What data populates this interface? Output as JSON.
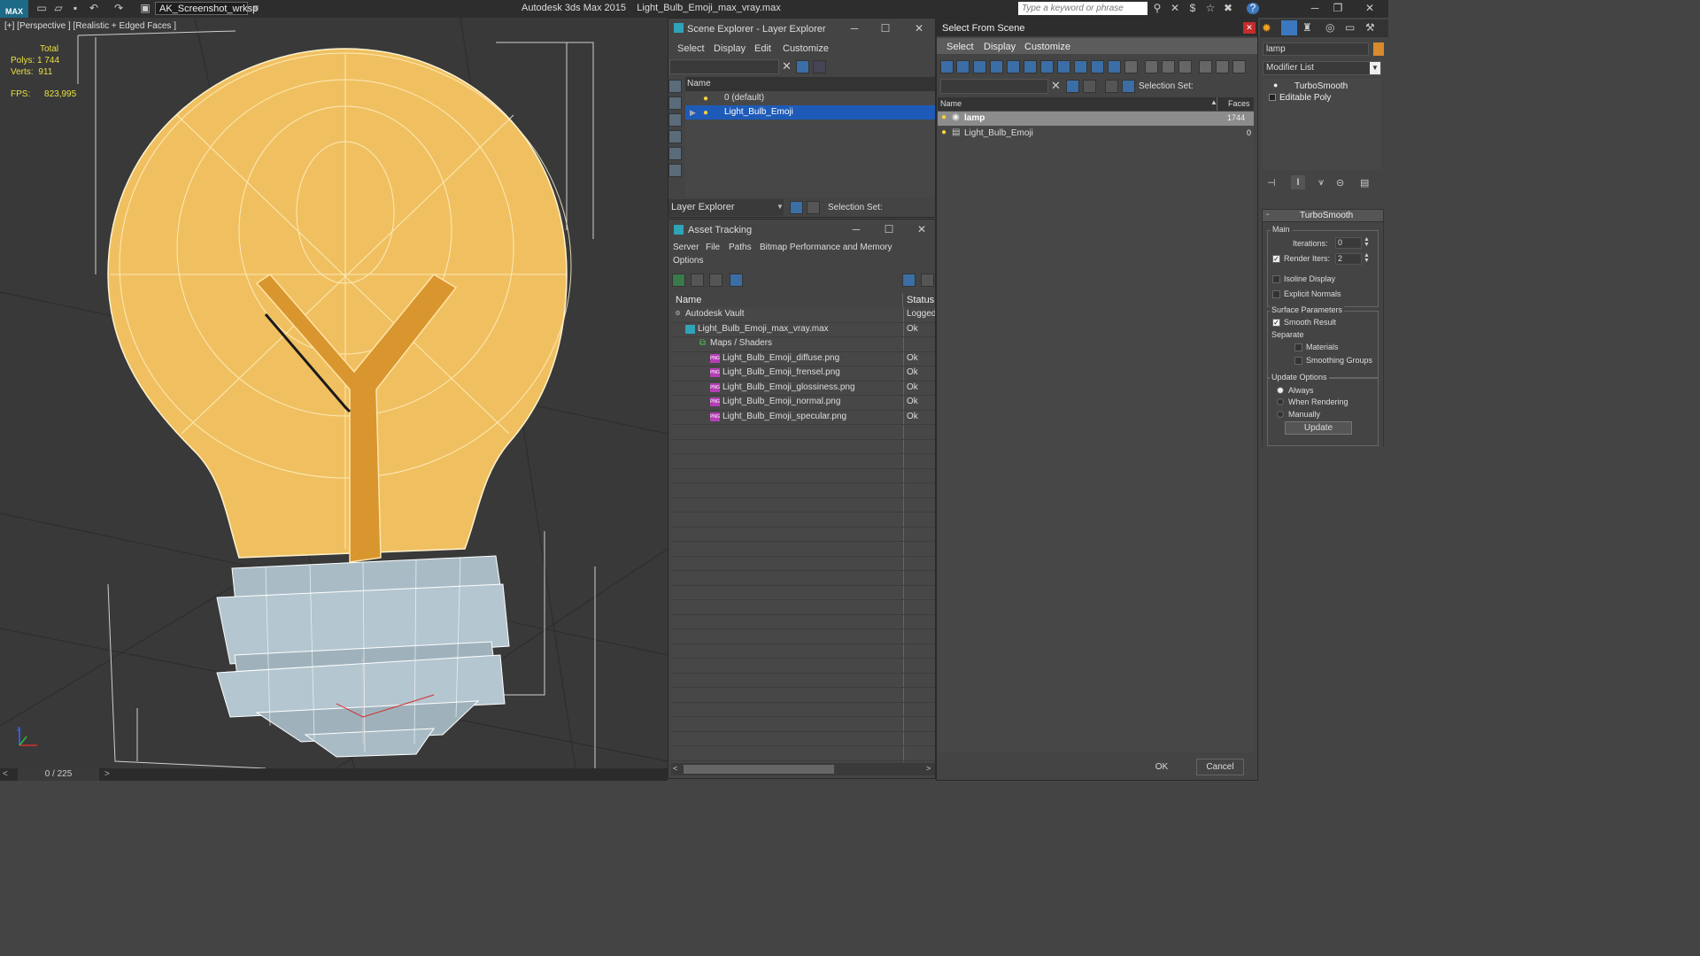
{
  "titlebar": {
    "workspace": "AK_Screenshot_wrksp",
    "app_name": "Autodesk 3ds Max  2015",
    "file_name": "Light_Bulb_Emoji_max_vray.max",
    "search_placeholder": "Type a keyword or phrase",
    "logo": "MAX"
  },
  "viewport": {
    "label": "[+] [Perspective ] [Realistic + Edged Faces ]",
    "stats_total": "Total",
    "polys_label": "Polys:",
    "polys_value": "1 744",
    "verts_label": "Verts:",
    "verts_value": "911",
    "fps_label": "FPS:",
    "fps_value": "823,995",
    "axis_z": "z",
    "frame_counter": "0 / 225",
    "colors": {
      "bulb": "#f0c060",
      "filament": "#d9962e",
      "base": "#a9bcc6",
      "bg": "#393939"
    }
  },
  "scene_explorer": {
    "title": "Scene Explorer - Layer Explorer",
    "menu": [
      "Select",
      "Display",
      "Edit",
      "Customize"
    ],
    "column_name": "Name",
    "rows": [
      {
        "label": "0 (default)",
        "selected": false
      },
      {
        "label": "Light_Bulb_Emoji",
        "selected": true
      }
    ],
    "footer_dropdown": "Layer Explorer",
    "selection_set_label": "Selection Set:"
  },
  "asset_tracking": {
    "title": "Asset Tracking",
    "menu": [
      "Server",
      "File",
      "Paths",
      "Bitmap Performance and Memory"
    ],
    "menu2": [
      "Options"
    ],
    "col_name": "Name",
    "col_status": "Status",
    "rows": [
      {
        "name": "Autodesk Vault",
        "status": "Logged",
        "indent": 0
      },
      {
        "name": "Light_Bulb_Emoji_max_vray.max",
        "status": "Ok",
        "indent": 1
      },
      {
        "name": "Maps / Shaders",
        "status": "",
        "indent": 2
      },
      {
        "name": "Light_Bulb_Emoji_diffuse.png",
        "status": "Ok",
        "indent": 3
      },
      {
        "name": "Light_Bulb_Emoji_frensel.png",
        "status": "Ok",
        "indent": 3
      },
      {
        "name": "Light_Bulb_Emoji_glossiness.png",
        "status": "Ok",
        "indent": 3
      },
      {
        "name": "Light_Bulb_Emoji_normal.png",
        "status": "Ok",
        "indent": 3
      },
      {
        "name": "Light_Bulb_Emoji_specular.png",
        "status": "Ok",
        "indent": 3
      }
    ]
  },
  "select_from_scene": {
    "title": "Select From Scene",
    "menu": [
      "Select",
      "Display",
      "Customize"
    ],
    "selection_set_label": "Selection Set:",
    "col_name": "Name",
    "col_faces": "Faces",
    "rows": [
      {
        "name": "lamp",
        "faces": "1744",
        "selected": true
      },
      {
        "name": "Light_Bulb_Emoji",
        "faces": "0",
        "selected": false
      }
    ],
    "ok_label": "OK",
    "cancel_label": "Cancel"
  },
  "command_panel": {
    "name_value": "lamp",
    "modifier_list": "Modifier List",
    "stack": [
      "TurboSmooth",
      "Editable Poly"
    ],
    "rollout_title": "TurboSmooth",
    "main_label": "Main",
    "iterations_label": "Iterations:",
    "iterations_value": "0",
    "render_iters_label": "Render Iters:",
    "render_iters_value": "2",
    "isoline_label": "Isoline Display",
    "explicit_normals_label": "Explicit Normals",
    "surface_params_label": "Surface Parameters",
    "smooth_result_label": "Smooth Result",
    "separate_label": "Separate",
    "materials_label": "Materials",
    "smoothing_groups_label": "Smoothing Groups",
    "update_options_label": "Update Options",
    "always_label": "Always",
    "when_rendering_label": "When Rendering",
    "manually_label": "Manually",
    "update_button": "Update"
  }
}
